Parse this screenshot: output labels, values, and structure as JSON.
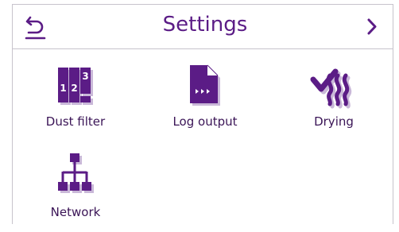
{
  "header": {
    "title": "Settings",
    "back_icon": "return-arrow-icon",
    "next_icon": "chevron-right-icon"
  },
  "tiles": [
    {
      "label": "Dust filter",
      "icon": "dust-filter-stages-icon",
      "stage_numbers": [
        "1",
        "2",
        "3"
      ]
    },
    {
      "label": "Log output",
      "icon": "log-output-document-icon"
    },
    {
      "label": "Drying",
      "icon": "drying-heat-waves-icon"
    },
    {
      "label": "Network",
      "icon": "network-tree-icon"
    }
  ],
  "colors": {
    "accent": "#5b1c86",
    "icon_shadow": "#c9b8d8",
    "frame": "#c7c3cc",
    "text": "#3a1456"
  }
}
